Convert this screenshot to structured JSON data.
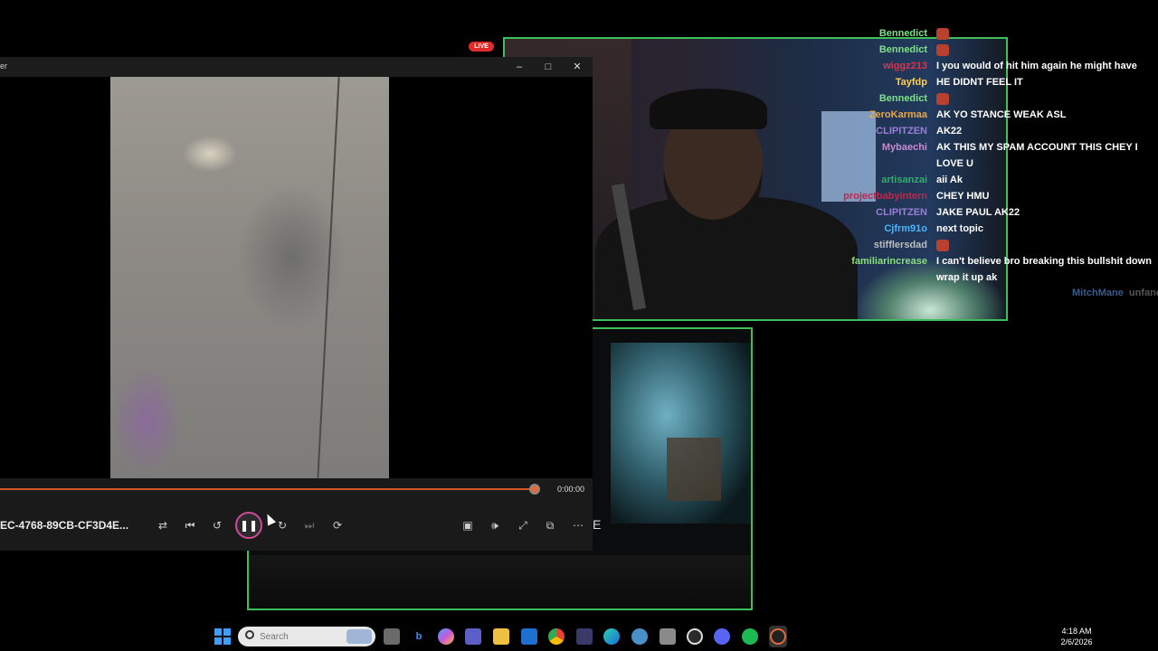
{
  "stream": {
    "live_badge": "LIVE"
  },
  "chat": {
    "lines": [
      {
        "name": "Bennedict",
        "message": "",
        "emote": true,
        "name_color": "#7fe08a"
      },
      {
        "name": "Bennedict",
        "message": "",
        "emote": true,
        "name_color": "#7fe08a"
      },
      {
        "name": "wiggz213",
        "message": "I you would of hit him again he might have",
        "emote": false,
        "name_color": "#e0314a"
      },
      {
        "name": "Tayfdp",
        "message": "HE DIDNT FEEL IT",
        "emote": false,
        "name_color": "#ffd24a"
      },
      {
        "name": "Bennedict",
        "message": "",
        "emote": true,
        "name_color": "#7fe08a"
      },
      {
        "name": "ZeroKarmaa",
        "message": "AK YO STANCE WEAK ASL",
        "emote": false,
        "name_color": "#e8a84a"
      },
      {
        "name": "CLIPITZEN",
        "message": "AK22",
        "emote": false,
        "name_color": "#9a7fd8"
      },
      {
        "name": "Mybaechi",
        "message": "AK THIS MY SPAM ACCOUNT THIS CHEY I",
        "emote": false,
        "name_color": "#c78ad0"
      },
      {
        "name": "",
        "message": "LOVE U",
        "emote": false,
        "name_color": "#c78ad0"
      },
      {
        "name": "artisanzai",
        "message": "aii Ak",
        "emote": false,
        "name_color": "#2fae6a"
      },
      {
        "name": "projectbabyintern",
        "message": "CHEY HMU",
        "emote": false,
        "name_color": "#c0264a"
      },
      {
        "name": "CLIPITZEN",
        "message": "JAKE PAUL AK22",
        "emote": false,
        "name_color": "#9a7fd8"
      },
      {
        "name": "Cjfrm91o",
        "message": "next topic",
        "emote": false,
        "name_color": "#4ab6ff"
      },
      {
        "name": "stifflersdad",
        "message": "",
        "emote": true,
        "name_color": "#bdbdbd"
      },
      {
        "name": "familiarincrease",
        "message": "I can't believe bro breaking this bullshit down",
        "emote": false,
        "name_color": "#8be07a"
      },
      {
        "name": "",
        "message": "wrap it up ak",
        "emote": false,
        "name_color": "#8be07a"
      }
    ],
    "faded_name": "MitchMane",
    "faded_message": "unfanc"
  },
  "player": {
    "title_fragment": "er",
    "minimize_icon": "minimize-icon",
    "maximize_icon": "maximize-icon",
    "close_icon": "close-icon",
    "time_display": "0:00:00",
    "progress_fraction": 0.99,
    "filename": "EC-4768-89CB-CF3D4E...",
    "accent_color": "#d6582a"
  },
  "overlay": {
    "letter": "E"
  },
  "taskbar": {
    "search_placeholder": "Search",
    "time": "4:18 AM",
    "date": "2/6/2026"
  }
}
